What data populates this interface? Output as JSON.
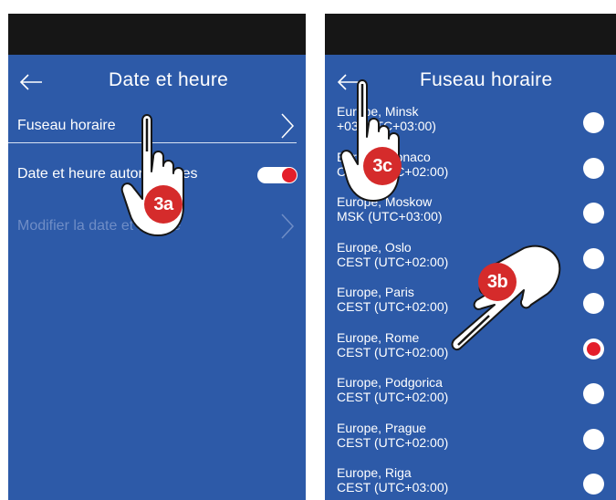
{
  "colors": {
    "screen_bg": "#2d5aa8",
    "status_bar": "#161616",
    "accent": "#e41e2a",
    "badge": "#d52b2b",
    "text": "#ffffff",
    "disabled_text": "#6f8dc6"
  },
  "left_screen": {
    "header": {
      "back_icon": "arrow-left-icon",
      "title": "Date et heure"
    },
    "rows": [
      {
        "label": "Fuseau horaire",
        "icon": "chevron-right-icon",
        "enabled": true
      },
      {
        "label": "Date et heure automatiques",
        "toggle_on": true,
        "enabled": true
      },
      {
        "label": "Modifier la date et l'heure",
        "icon": "chevron-right-icon",
        "enabled": false
      }
    ]
  },
  "right_screen": {
    "header": {
      "back_icon": "arrow-left-icon",
      "title": "Fuseau horaire"
    },
    "timezones": [
      {
        "name": "Europe, Minsk",
        "offset": "+03 (UTC+03:00)",
        "selected": false
      },
      {
        "name": "Europe, Monaco",
        "offset": "CEST (UTC+02:00)",
        "selected": false
      },
      {
        "name": "Europe, Moskow",
        "offset": "MSK (UTC+03:00)",
        "selected": false
      },
      {
        "name": "Europe, Oslo",
        "offset": "CEST (UTC+02:00)",
        "selected": false
      },
      {
        "name": "Europe, Paris",
        "offset": "CEST (UTC+02:00)",
        "selected": false
      },
      {
        "name": "Europe, Rome",
        "offset": "CEST (UTC+02:00)",
        "selected": true
      },
      {
        "name": "Europe, Podgorica",
        "offset": "CEST (UTC+02:00)",
        "selected": false
      },
      {
        "name": "Europe, Prague",
        "offset": "CEST (UTC+02:00)",
        "selected": false
      },
      {
        "name": "Europe, Riga",
        "offset": "CEST (UTC+03:00)",
        "selected": false
      }
    ]
  },
  "annotations": [
    {
      "label": "3a",
      "icon": "pointing-hand-icon"
    },
    {
      "label": "3b",
      "icon": "pointing-hand-icon"
    },
    {
      "label": "3c",
      "icon": "pointing-hand-icon"
    }
  ]
}
